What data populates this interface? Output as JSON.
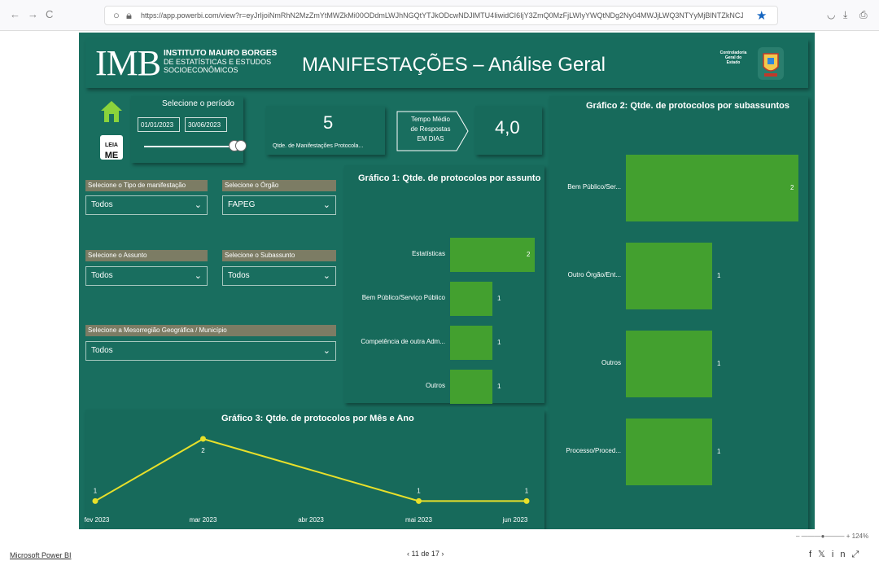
{
  "browser": {
    "url": "https://app.powerbi.com/view?r=eyJrIjoiNmRhN2MzZmYtMWZkMi00ODdmLWJhNGQtYTJkODcwNDJlMTU4IiwidCI6IjY3ZmQ0MzFjLWIyYWQtNDg2Ny04MWJjLWQ3NTYyMjBlNTZkNCJ9",
    "back_icon": "←",
    "forward_icon": "→",
    "reload_icon": "C",
    "star_icon": "★"
  },
  "header": {
    "logo_main": "IMB",
    "logo_line1": "INSTITUTO MAURO BORGES",
    "logo_line2": "DE ESTATÍSTICAS E ESTUDOS",
    "logo_line3": "SOCIOECONÔMICOS",
    "title": "MANIFESTAÇÕES  –  Análise Geral",
    "seal_line1": "Controladoria",
    "seal_line2": "Geral do",
    "seal_line3": "Estado"
  },
  "period": {
    "label": "Selecione o período",
    "start": "01/01/2023",
    "end": "30/06/2023"
  },
  "leia_me": {
    "line1": "LEIA",
    "line2": "ME"
  },
  "kpi": {
    "count_value": "5",
    "count_label": "Qtde. de Manifestações Protocola...",
    "avg_label_line1": "Tempo Médio",
    "avg_label_line2": "de Respostas",
    "avg_label_line3": "EM DIAS",
    "avg_value": "4,0"
  },
  "filters": {
    "tipo": {
      "label": "Selecione o Tipo de manifestação",
      "value": "Todos"
    },
    "orgao": {
      "label": "Selecione o Órgão",
      "value": "FAPEG"
    },
    "assunto": {
      "label": "Selecione o Assunto",
      "value": "Todos"
    },
    "subassunto": {
      "label": "Selecione o Subassunto",
      "value": "Todos"
    },
    "meso": {
      "label": "Selecione a Mesorregião Geográfica / Município",
      "value": "Todos"
    }
  },
  "chart_data": [
    {
      "type": "bar",
      "title": "Gráfico 1: Qtde. de protocolos por assunto",
      "categories": [
        "Estatísticas",
        "Bem Público/Serviço Público",
        "Competência de outra Adm...",
        "Outros"
      ],
      "values": [
        2,
        1,
        1,
        1
      ]
    },
    {
      "type": "bar",
      "title": "Gráfico 2: Qtde. de protocolos por subassuntos",
      "categories": [
        "Bem Público/Ser...",
        "Outro Órgão/Ent...",
        "Outros",
        "Processo/Proced..."
      ],
      "values": [
        2,
        1,
        1,
        1
      ]
    },
    {
      "type": "line",
      "title": "Gráfico 3: Qtde. de protocolos por Mês e Ano",
      "x": [
        "fev 2023",
        "mar 2023",
        "abr 2023",
        "mai 2023",
        "jun 2023"
      ],
      "points": [
        {
          "x": "fev 2023",
          "y": 1
        },
        {
          "x": "mar 2023",
          "y": 2
        },
        {
          "x": "mai 2023",
          "y": 1
        },
        {
          "x": "jun 2023",
          "y": 1
        }
      ],
      "color": "#e8e02a"
    }
  ],
  "footer": {
    "link": "Microsoft Power BI",
    "pager": "‹   11 de 17   ›",
    "zoom": "124%"
  },
  "colors": {
    "background": "#196e5f",
    "bar": "#43a02f",
    "line": "#e8e02a"
  }
}
